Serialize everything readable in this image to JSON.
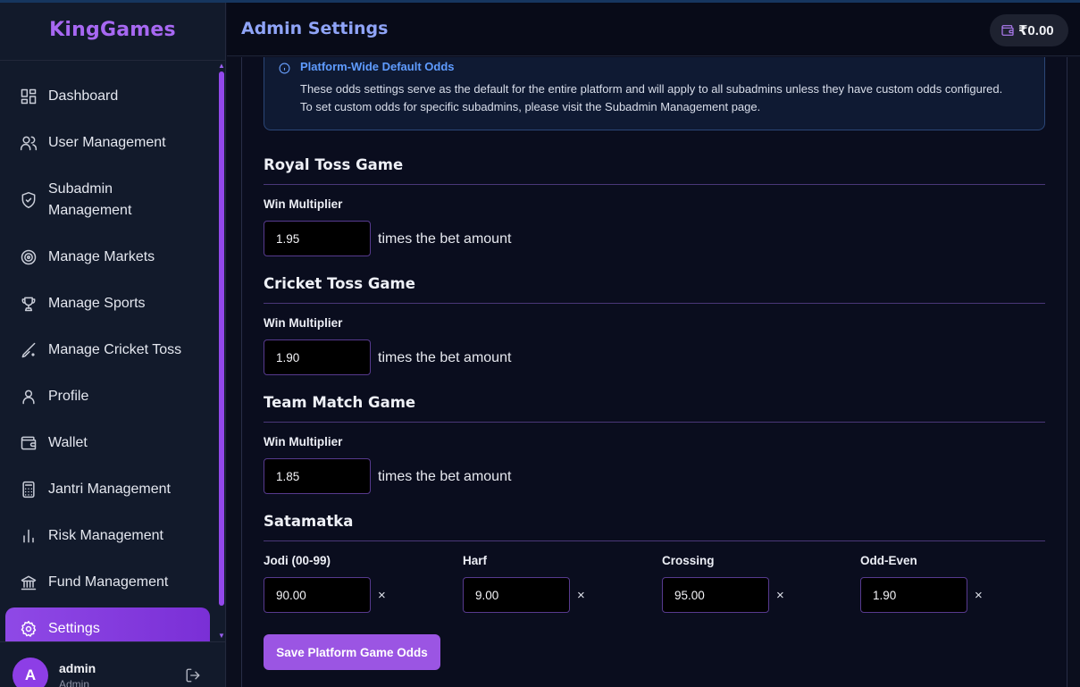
{
  "app": {
    "brand": "KingGames"
  },
  "header": {
    "title": "Admin Settings",
    "balance": "₹0.00"
  },
  "sidebar": {
    "items": [
      {
        "label": "Dashboard",
        "icon": "dashboard-icon"
      },
      {
        "label": "User Management",
        "icon": "users-icon"
      },
      {
        "label": "Subadmin Management",
        "icon": "shield-icon"
      },
      {
        "label": "Manage Markets",
        "icon": "target-icon"
      },
      {
        "label": "Manage Sports",
        "icon": "trophy-icon"
      },
      {
        "label": "Manage Cricket Toss",
        "icon": "bat-icon"
      },
      {
        "label": "Profile",
        "icon": "user-icon"
      },
      {
        "label": "Wallet",
        "icon": "wallet-icon"
      },
      {
        "label": "Jantri Management",
        "icon": "calculator-icon"
      },
      {
        "label": "Risk Management",
        "icon": "bar-chart-icon"
      },
      {
        "label": "Fund Management",
        "icon": "bank-icon"
      },
      {
        "label": "Settings",
        "icon": "gear-icon",
        "active": true
      }
    ],
    "user": {
      "avatar_letter": "A",
      "name": "admin",
      "role": "Admin"
    }
  },
  "info": {
    "title": "Platform-Wide Default Odds",
    "text": "These odds settings serve as the default for the entire platform and will apply to all subadmins unless they have custom odds configured. To set custom odds for specific subadmins, please visit the Subadmin Management page."
  },
  "games": [
    {
      "title": "Royal Toss Game",
      "label": "Win Multiplier",
      "value": "1.95",
      "suffix": "times the bet amount"
    },
    {
      "title": "Cricket Toss Game",
      "label": "Win Multiplier",
      "value": "1.90",
      "suffix": "times the bet amount"
    },
    {
      "title": "Team Match Game",
      "label": "Win Multiplier",
      "value": "1.85",
      "suffix": "times the bet amount"
    }
  ],
  "satamatka": {
    "title": "Satamatka",
    "fields": [
      {
        "label": "Jodi (00-99)",
        "value": "90.00",
        "unit": "×"
      },
      {
        "label": "Harf",
        "value": "9.00",
        "unit": "×"
      },
      {
        "label": "Crossing",
        "value": "95.00",
        "unit": "×"
      },
      {
        "label": "Odd-Even",
        "value": "1.90",
        "unit": "×"
      }
    ]
  },
  "actions": {
    "save_label": "Save Platform Game Odds"
  },
  "colors": {
    "accent": "#9b55e3",
    "info": "#5f9cff",
    "background": "#0b0e1d"
  }
}
